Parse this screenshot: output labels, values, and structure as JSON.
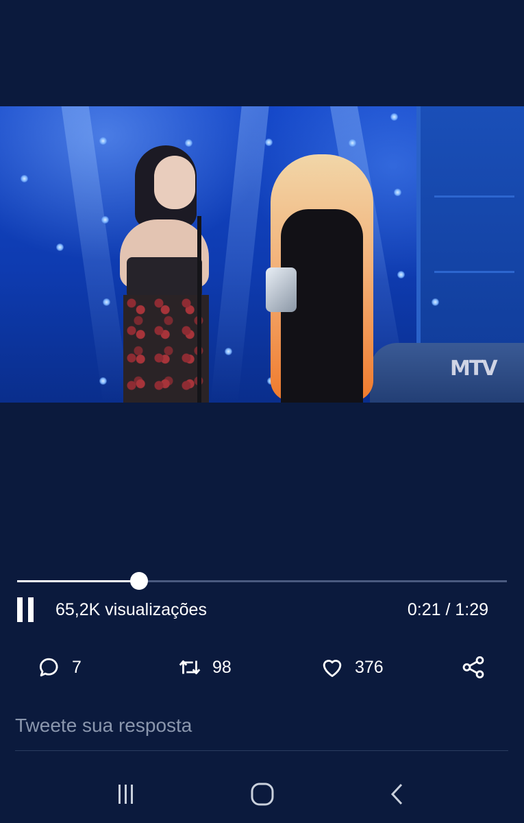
{
  "video": {
    "watermark": "MTV"
  },
  "player": {
    "progress_fraction": 0.249,
    "views_text": "65,2K visualizações",
    "time_text": "0:21 / 1:29"
  },
  "actions": {
    "replies": "7",
    "retweets": "98",
    "likes": "376"
  },
  "reply_box": {
    "placeholder": "Tweete sua resposta"
  },
  "colors": {
    "background": "#0b1a3d",
    "text": "#ffffff",
    "muted_text": "#8a96ad"
  },
  "icons": {
    "pause": "pause-icon",
    "reply": "reply-icon",
    "retweet": "retweet-icon",
    "like": "heart-icon",
    "share": "share-icon",
    "nav_recents": "recent-apps-icon",
    "nav_home": "home-icon",
    "nav_back": "back-icon"
  }
}
